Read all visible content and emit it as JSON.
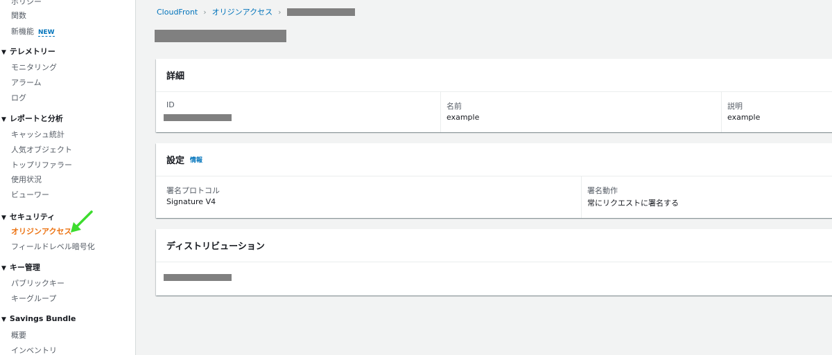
{
  "sidebar": {
    "items_top": [
      {
        "label": "ポリシー"
      },
      {
        "label": "関数"
      },
      {
        "label": "新機能",
        "badge": "NEW"
      }
    ],
    "sections": [
      {
        "title": "テレメトリー",
        "items": [
          "モニタリング",
          "アラーム",
          "ログ"
        ]
      },
      {
        "title": "レポートと分析",
        "items": [
          "キャッシュ統計",
          "人気オブジェクト",
          "トップリファラー",
          "使用状況",
          "ビューワー"
        ]
      },
      {
        "title": "セキュリティ",
        "items": [
          "オリジンアクセス",
          "フィールドレベル暗号化"
        ]
      },
      {
        "title": "キー管理",
        "items": [
          "パブリックキー",
          "キーグループ"
        ]
      },
      {
        "title": "Savings Bundle",
        "items": [
          "概要",
          "インベントリ"
        ]
      }
    ],
    "active_item": "オリジンアクセス",
    "caret": "▼"
  },
  "breadcrumb": {
    "items": [
      "CloudFront",
      "オリジンアクセス"
    ],
    "separator": "›"
  },
  "details_card": {
    "title": "詳細",
    "fields": [
      {
        "label": "ID",
        "value": ""
      },
      {
        "label": "名前",
        "value": "example"
      },
      {
        "label": "説明",
        "value": "example"
      }
    ]
  },
  "settings_card": {
    "title": "設定",
    "info_link": "情報",
    "fields": [
      {
        "label": "署名プロトコル",
        "value": "Signature V4"
      },
      {
        "label": "署名動作",
        "value": "常にリクエストに署名する"
      }
    ]
  },
  "distribution_card": {
    "title": "ディストリビューション"
  },
  "colors": {
    "accent_orange": "#ec7211",
    "link_blue": "#0073bb",
    "arrow_green": "#3ddc2e",
    "redaction": "#808080"
  }
}
